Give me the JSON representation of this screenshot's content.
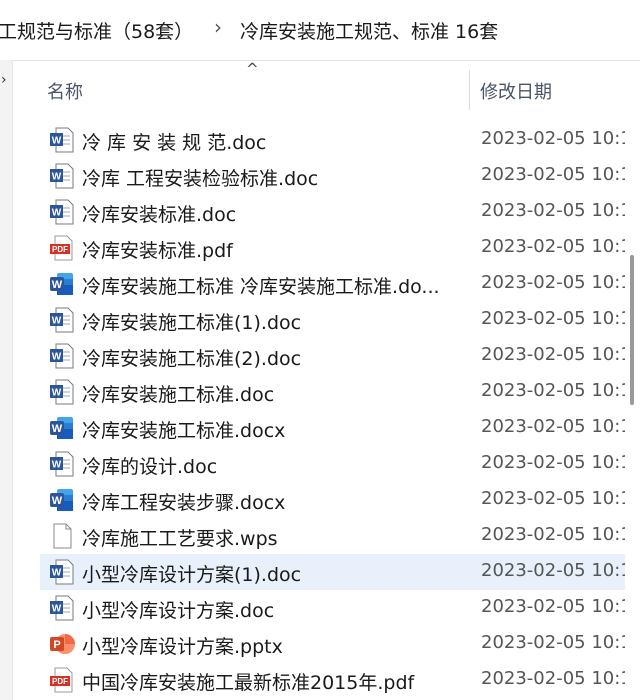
{
  "breadcrumb": {
    "parent": "工规范与标准（58套）",
    "separator": "›",
    "current": "冷库安装施工规范、标准 16套"
  },
  "columns": {
    "name": "名称",
    "date": "修改日期"
  },
  "files": [
    {
      "name": "冷 库 安 装 规 范.doc",
      "date": "2023-02-05 10:1",
      "icon": "word-doc-icon"
    },
    {
      "name": "冷库 工程安装检验标准.doc",
      "date": "2023-02-05 10:1",
      "icon": "word-doc-icon"
    },
    {
      "name": "冷库安装标准.doc",
      "date": "2023-02-05 10:1",
      "icon": "word-doc-icon"
    },
    {
      "name": "冷库安装标准.pdf",
      "date": "2023-02-05 10:1",
      "icon": "pdf-icon"
    },
    {
      "name": "冷库安装施工标准 冷库安装施工标准.do...",
      "date": "2023-02-05 10:1",
      "icon": "word-docx-icon"
    },
    {
      "name": "冷库安装施工标准(1).doc",
      "date": "2023-02-05 10:1",
      "icon": "word-doc-icon"
    },
    {
      "name": "冷库安装施工标准(2).doc",
      "date": "2023-02-05 10:1",
      "icon": "word-doc-icon"
    },
    {
      "name": "冷库安装施工标准.doc",
      "date": "2023-02-05 10:1",
      "icon": "word-doc-icon"
    },
    {
      "name": "冷库安装施工标准.docx",
      "date": "2023-02-05 10:1",
      "icon": "word-docx-icon"
    },
    {
      "name": "冷库的设计.doc",
      "date": "2023-02-05 10:1",
      "icon": "word-doc-icon"
    },
    {
      "name": "冷库工程安装步骤.docx",
      "date": "2023-02-05 10:1",
      "icon": "word-docx-icon"
    },
    {
      "name": "冷库施工工艺要求.wps",
      "date": "2023-02-05 10:1",
      "icon": "blank-file-icon"
    },
    {
      "name": "小型冷库设计方案(1).doc",
      "date": "2023-02-05 10:1",
      "icon": "word-doc-icon",
      "selected": true
    },
    {
      "name": "小型冷库设计方案.doc",
      "date": "2023-02-05 10:1",
      "icon": "word-doc-icon"
    },
    {
      "name": "小型冷库设计方案.pptx",
      "date": "2023-02-05 10:1",
      "icon": "pptx-icon"
    },
    {
      "name": "中国冷库安装施工最新标准2015年.pdf",
      "date": "2023-02-05 10:1",
      "icon": "pdf-icon"
    }
  ],
  "colors": {
    "word": "#2b579a",
    "pdf": "#d93025",
    "pptx": "#d24726",
    "selected_row": "#e8f1fb"
  }
}
